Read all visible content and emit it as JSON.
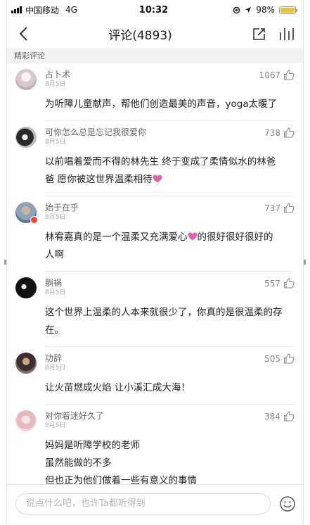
{
  "status_bar": {
    "carrier": "中国移动",
    "network": "4G",
    "time": "10:32",
    "battery": "98%",
    "battery_level": 0.98
  },
  "nav": {
    "title": "评论(4893)"
  },
  "section": {
    "label": "精彩评论"
  },
  "comments": [
    {
      "user": "占卜术",
      "date": "8月5日",
      "likes": "1067",
      "lines": [
        "为听障儿童献声，帮他们创造最美的声音，yoga太暖了"
      ]
    },
    {
      "user": "可你怎么总是忘记我很爱你",
      "date": "8月5日",
      "likes": "738",
      "lines": [
        "以前唱着爱而不得的林先生  终于变成了柔情似水的林爸",
        "爸  愿你被这世界温柔相待"
      ]
    },
    {
      "user": "始于在乎",
      "date": "8月5日",
      "likes": "737",
      "lines": [
        "林宥嘉真的是一个温柔又充满爱心",
        "的很好很好很好的",
        "人啊"
      ]
    },
    {
      "user": "躺祸",
      "date": "8月5日",
      "likes": "557",
      "lines": [
        "这个世界上温柔的人本来就很少了，你真的是很温柔的存",
        "在。"
      ]
    },
    {
      "user": "功辞",
      "date": "8月5日",
      "likes": "505",
      "lines": [
        "让火苗燃成火焰 让小溪汇成大海！"
      ]
    },
    {
      "user": "对你着迷好久了",
      "date": "8月5日",
      "likes": "384",
      "lines": [
        "妈妈是听障学校的老师",
        "虽然能做的不多",
        "但也正为他们做着一些有意义的事情"
      ]
    }
  ],
  "input": {
    "placeholder": "说点什么吧，也许Ta都听得到"
  },
  "colors": {
    "heart": "#e35fb0",
    "battery": "#f2c230"
  }
}
